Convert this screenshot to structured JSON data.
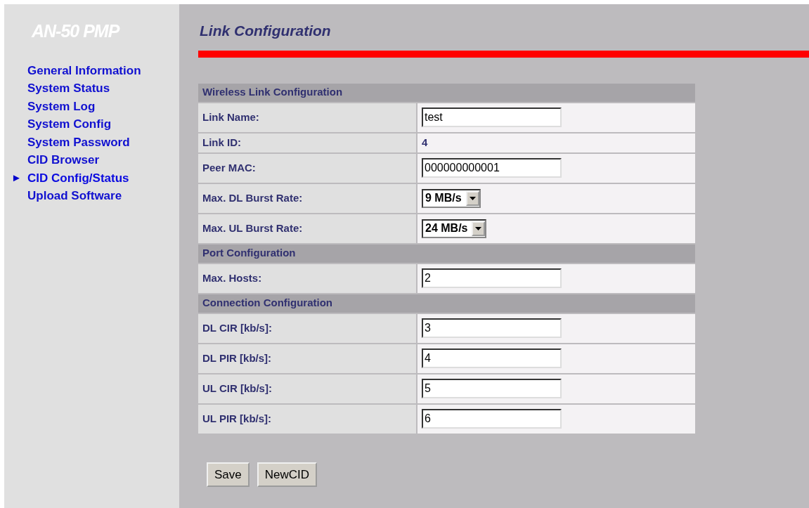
{
  "sidebar": {
    "logo": "AN-50 PMP",
    "items": [
      {
        "label": "General Information",
        "selected": false
      },
      {
        "label": "System Status",
        "selected": false
      },
      {
        "label": "System Log",
        "selected": false
      },
      {
        "label": "System Config",
        "selected": false
      },
      {
        "label": "System Password",
        "selected": false
      },
      {
        "label": "CID Browser",
        "selected": false
      },
      {
        "label": "CID Config/Status",
        "selected": true,
        "marker": "►"
      },
      {
        "label": "Upload Software",
        "selected": false
      }
    ]
  },
  "page_title": "Link Configuration",
  "sections": [
    {
      "title": "Wireless Link Configuration",
      "rows": [
        {
          "label": "Link Name:",
          "kind": "input",
          "value": "test"
        },
        {
          "label": "Link ID:",
          "kind": "static",
          "value": "4"
        },
        {
          "label": "Peer MAC:",
          "kind": "input",
          "value": "000000000001"
        },
        {
          "label": "Max. DL Burst Rate:",
          "kind": "select",
          "value": "9 MB/s"
        },
        {
          "label": "Max. UL Burst Rate:",
          "kind": "select",
          "value": "24 MB/s"
        }
      ]
    },
    {
      "title": "Port Configuration",
      "rows": [
        {
          "label": "Max. Hosts:",
          "kind": "input",
          "value": "2"
        }
      ]
    },
    {
      "title": "Connection Configuration",
      "rows": [
        {
          "label": "DL CIR [kb/s]:",
          "kind": "input",
          "value": "3"
        },
        {
          "label": "DL PIR [kb/s]:",
          "kind": "input",
          "value": "4"
        },
        {
          "label": "UL CIR [kb/s]:",
          "kind": "input",
          "value": "5"
        },
        {
          "label": "UL PIR [kb/s]:",
          "kind": "input",
          "value": "6"
        }
      ]
    }
  ],
  "buttons": [
    "Save",
    "NewCID"
  ]
}
